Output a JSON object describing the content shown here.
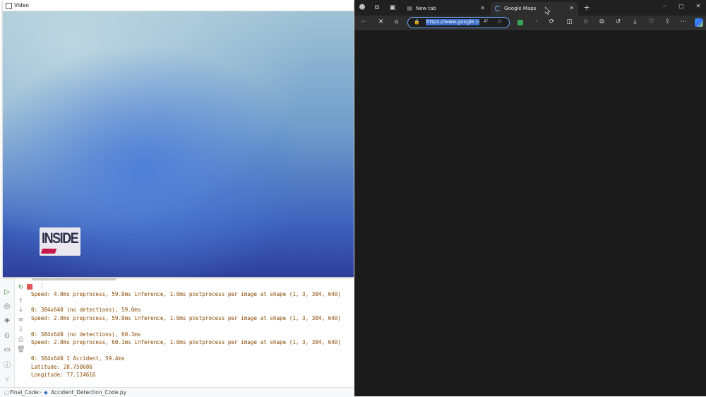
{
  "video_window": {
    "title": "Video",
    "logo_text": "INSIDE"
  },
  "ide": {
    "console_lines": [
      "Speed: 4.0ms preprocess, 59.0ms inference, 1.0ms postprocess per image at shape (1, 3, 384, 640)",
      "0: 384x640 (no detections), 59.0ms",
      "Speed: 2.0ms preprocess, 59.0ms inference, 1.0ms postprocess per image at shape (1, 3, 384, 640)",
      "0: 384x640 (no detections), 60.1ms",
      "Speed: 2.0ms preprocess, 60.1ms inference, 1.0ms postprocess per image at shape (1, 3, 384, 640)",
      "0: 384x640 1 Accident, 59.4ms",
      "Latitude: 28.750686",
      "Longitude: 77.114616"
    ],
    "status": {
      "project": "Final_Code",
      "separator": ">",
      "file": "Accident_Detection_Code.py"
    }
  },
  "browser": {
    "tabs": [
      {
        "label": "New tab",
        "active": false
      },
      {
        "label": "Google Maps",
        "active": true
      }
    ],
    "address": {
      "url": "https://www.google.com/"
    }
  }
}
